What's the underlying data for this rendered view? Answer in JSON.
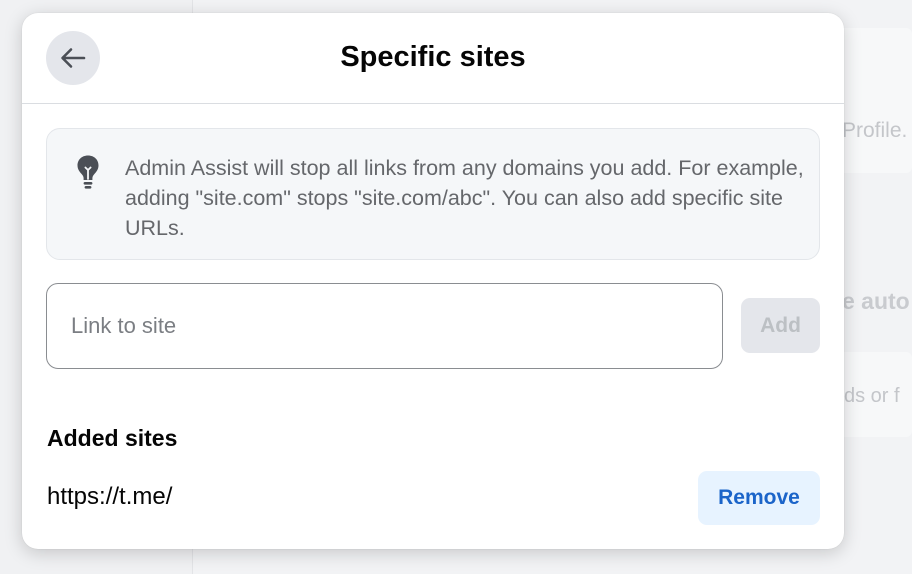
{
  "background": {
    "profile_text": "Profile.",
    "auto_text": "e auto",
    "words_text": "ds or f"
  },
  "dialog": {
    "title": "Specific sites",
    "back_icon": "arrow-left-icon",
    "info": {
      "icon": "lightbulb-icon",
      "text": "Admin Assist will stop all links from any domains you add. For example, adding \"site.com\" stops \"site.com/abc\". You can also add specific site URLs."
    },
    "link_input": {
      "placeholder": "Link to site",
      "value": ""
    },
    "add_label": "Add",
    "added_sites_heading": "Added sites",
    "sites": [
      {
        "url": "https://t.me/",
        "remove_label": "Remove"
      }
    ]
  },
  "colors": {
    "remove_text": "#1b64c9",
    "remove_bg": "#e7f3ff",
    "add_disabled_bg": "#e4e6eb",
    "add_disabled_text": "#bcc0c4"
  }
}
